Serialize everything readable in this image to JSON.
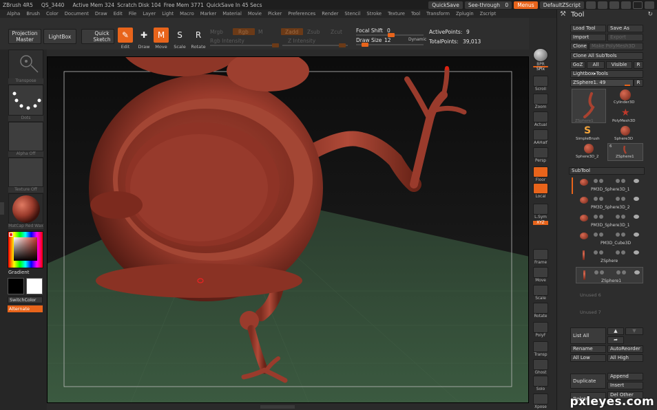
{
  "titlebar": {
    "app": "ZBrush 4R5",
    "qs": "QS_3440",
    "active_mem": "Active Mem 324",
    "scratch": "Scratch Disk 104",
    "free_mem": "Free Mem 3771",
    "quicksave_in": "QuickSave In 45 Secs",
    "quicksave_btn": "QuickSave",
    "seethrough": "See-through",
    "seethrough_val": "0",
    "menus_btn": "Menus",
    "default_script": "DefaultZScript"
  },
  "menu": [
    "Alpha",
    "Brush",
    "Color",
    "Document",
    "Draw",
    "Edit",
    "File",
    "Layer",
    "Light",
    "Macro",
    "Marker",
    "Material",
    "Movie",
    "Picker",
    "Preferences",
    "Render",
    "Stencil",
    "Stroke",
    "Texture",
    "Tool",
    "Transform",
    "Zplugin",
    "Zscript"
  ],
  "shelf": {
    "projection_master": "Projection Master",
    "lightbox": "LightBox",
    "quick_sketch": "Quick Sketch",
    "edit": "Edit",
    "draw": "Draw",
    "move": "Move",
    "scale": "Scale",
    "rotate": "Rotate",
    "mrgb": "Mrgb",
    "rgb": "Rgb",
    "m": "M",
    "rgb_intensity": "Rgb Intensity",
    "zadd": "Zadd",
    "zsub": "Zsub",
    "zcut": "Zcut",
    "z_intensity": "Z Intensity",
    "focal_shift_label": "Focal Shift",
    "focal_shift_val": "0",
    "draw_size_label": "Draw Size",
    "draw_size_val": "12",
    "dynamic": "Dynamic",
    "active_points_label": "ActivePoints:",
    "active_points_val": "9",
    "total_points_label": "TotalPoints:",
    "total_points_val": "39,013"
  },
  "lefttray": {
    "transpose": "Transpose",
    "dots": "Dots",
    "alpha_off": "Alpha Off",
    "texture_off": "Texture Off",
    "matcap": "MatCap Red Wax",
    "gradient": "Gradient",
    "switchcolor": "SwitchColor",
    "alternate": "Alternate"
  },
  "rightshelf": [
    "BPR",
    "SPix",
    "Scroll",
    "Zoom",
    "Actual",
    "AAHalf",
    "Persp",
    "Floor",
    "Local",
    "L.Sym",
    "XYZ",
    "Frame",
    "Move",
    "Scale",
    "Rotate",
    "PolyF",
    "Transp",
    "Ghost",
    "Solo",
    "Xpose"
  ],
  "palette": {
    "title": "Tool",
    "load_tool": "Load Tool",
    "save_as": "Save As",
    "import": "Import",
    "export": "Export",
    "clone": "Clone",
    "make_polymesh": "Make PolyMesh3D",
    "clone_all": "Clone All SubTools",
    "goz": "GoZ",
    "all": "All",
    "visible": "Visible",
    "r": "R",
    "lightbox_tools": "Lightbox▸Tools",
    "zsphere_label": "ZSphere1. 49",
    "tools": [
      "ZSphere1",
      "Cylinder3D",
      "PolyMesh3D",
      "SimpleBrush",
      "Sphere3D",
      "Sphere3D_2",
      "ZSphere1"
    ],
    "tool_count": "6",
    "subtool_header": "SubTool",
    "subtools": [
      "PM3D_Sphere3D_1",
      "PM3D_Sphere3D_2",
      "PM3D_Sphere3D_1",
      "PM3D_Cube3D",
      "ZSphere",
      "ZSphere1"
    ],
    "unused": [
      "Unused 6",
      "Unused 7"
    ],
    "list_all": "List All",
    "rename": "Rename",
    "auto_reorder": "AutoReorder",
    "all_low": "All Low",
    "all_high": "All High",
    "duplicate": "Duplicate",
    "append": "Append",
    "insert": "Insert",
    "del_other": "Del Other",
    "delete": "Delete"
  },
  "watermark": "pxleyes.com",
  "colors": {
    "accent": "#e8641b",
    "model": "#9a3b2c",
    "floor": "#2f4a34"
  }
}
